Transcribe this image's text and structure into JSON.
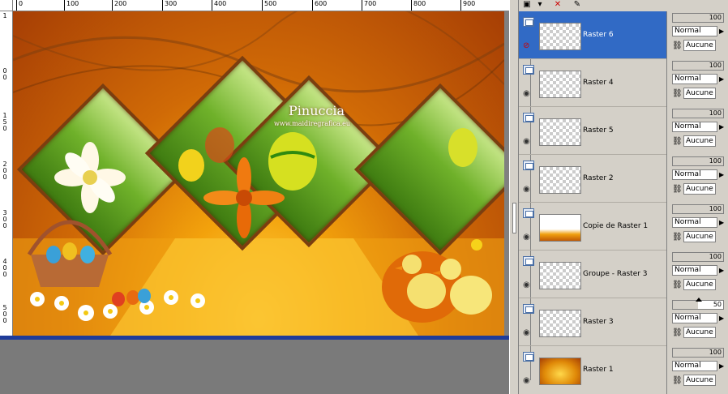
{
  "watermark": {
    "title": "Pinuccia",
    "url": "www.maidiregrafica.eu"
  },
  "ruler": {
    "top": [
      "0",
      "100",
      "200",
      "300",
      "400",
      "500",
      "600",
      "700",
      "800",
      "900"
    ],
    "left": [
      "1",
      "0 0",
      "1 5 0",
      "2 0 0",
      "3 0 0",
      "4 0 0",
      "5 0 0",
      "3 0 0"
    ]
  },
  "layers": [
    {
      "name": "Raster 6",
      "selected": true,
      "opacity": "100",
      "blend": "Normal",
      "mask": "Aucune"
    },
    {
      "name": "Raster 4",
      "selected": false,
      "opacity": "100",
      "blend": "Normal",
      "mask": "Aucune"
    },
    {
      "name": "Raster 5",
      "selected": false,
      "opacity": "100",
      "blend": "Normal",
      "mask": "Aucune"
    },
    {
      "name": "Raster 2",
      "selected": false,
      "opacity": "100",
      "blend": "Normal",
      "mask": "Aucune"
    },
    {
      "name": "Copie de Raster 1",
      "selected": false,
      "opacity": "100",
      "blend": "Normal",
      "mask": "Aucune"
    },
    {
      "name": "Groupe - Raster 3",
      "selected": false,
      "opacity": "100",
      "blend": "Normal",
      "mask": "Aucune"
    },
    {
      "name": "Raster 3",
      "selected": false,
      "opacity": "50",
      "blend": "Normal",
      "mask": "Aucune"
    },
    {
      "name": "Raster 1",
      "selected": false,
      "opacity": "100",
      "blend": "Normal",
      "mask": "Aucune"
    }
  ],
  "icons": {
    "layer": "layer-icon",
    "visible": "eye-icon",
    "visible_selected": "eye-hidden-icon",
    "link": "link-icon",
    "new_layer": "new-layer-icon",
    "delete": "delete-layer-icon",
    "properties": "properties-icon"
  },
  "colors": {
    "selection": "#316ac5",
    "canvas_border": "#1f3c9a",
    "workspace": "#7a7a7a"
  }
}
